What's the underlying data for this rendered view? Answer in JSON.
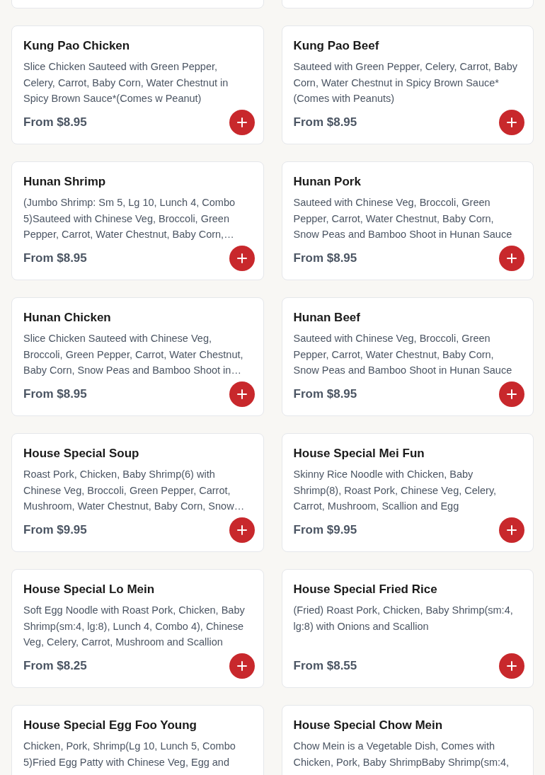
{
  "menu_items": [
    {
      "kind": "cut_off"
    },
    {
      "kind": "cut_off"
    },
    {
      "kind": "dish",
      "title": "Kung Pao Chicken",
      "description": "Slice Chicken Sauteed with Green Pepper, Celery, Carrot, Baby Corn, Water Chestnut in Spicy Brown Sauce*(Comes w Peanut)",
      "price": "From $8.95"
    },
    {
      "kind": "dish",
      "title": "Kung Pao Beef",
      "description": "Sauteed with Green Pepper, Celery, Carrot, Baby Corn, Water Chestnut in Spicy Brown Sauce* (Comes with Peanuts)",
      "price": "From $8.95"
    },
    {
      "kind": "dish",
      "title": "Hunan Shrimp",
      "description": "(Jumbo Shrimp: Sm 5, Lg 10, Lunch 4, Combo 5)Sauteed with Chinese Veg, Broccoli, Green Pepper, Carrot, Water Chestnut, Baby Corn,…",
      "price": "From $8.95"
    },
    {
      "kind": "dish",
      "title": "Hunan Pork",
      "description": "Sauteed with Chinese Veg, Broccoli, Green Pepper, Carrot, Water Chestnut, Baby Corn, Snow Peas and Bamboo Shoot in Hunan Sauce",
      "price": "From $8.95"
    },
    {
      "kind": "dish",
      "title": "Hunan Chicken",
      "description": "Slice Chicken Sauteed with Chinese Veg, Broccoli, Green Pepper, Carrot, Water Chestnut, Baby Corn, Snow Peas and Bamboo Shoot in…",
      "price": "From $8.95"
    },
    {
      "kind": "dish",
      "title": "Hunan Beef",
      "description": "Sauteed with Chinese Veg, Broccoli, Green Pepper, Carrot, Water Chestnut, Baby Corn, Snow Peas and Bamboo Shoot in Hunan Sauce",
      "price": "From $8.95"
    },
    {
      "kind": "dish",
      "title": "House Special Soup",
      "description": "Roast Pork, Chicken, Baby Shrimp(6) with Chinese Veg, Broccoli, Green Pepper, Carrot, Mushroom, Water Chestnut, Baby Corn, Snow…",
      "price": "From $9.95"
    },
    {
      "kind": "dish",
      "title": "House Special Mei Fun",
      "description": "Skinny Rice Noodle with Chicken, Baby Shrimp(8), Roast Pork, Chinese Veg, Celery, Carrot, Mushroom, Scallion and Egg",
      "price": "From $9.95"
    },
    {
      "kind": "dish",
      "title": "House Special Lo Mein",
      "description": "Soft Egg Noodle with Roast Pork, Chicken, Baby Shrimp(sm:4, lg:8), Lunch 4, Combo 4), Chinese Veg, Celery, Carrot, Mushroom and Scallion",
      "price": "From $8.25"
    },
    {
      "kind": "dish",
      "title": "House Special Fried Rice",
      "description": "(Fried) Roast Pork, Chicken, Baby Shrimp(sm:4, lg:8) with Onions and Scallion",
      "price": "From $8.55"
    },
    {
      "kind": "dish",
      "title": "House Special Egg Foo Young",
      "description": "Chicken, Pork, Shrimp(Lg 10, Lunch 5, Combo 5)Fried Egg Patty with Chinese Veg, Egg and"
    },
    {
      "kind": "dish",
      "title": "House Special Chow Mein",
      "description": "Chow Mein is a Vegetable Dish, Comes with Chicken, Pork, Baby ShrimpBaby Shrimp(sm:4,"
    }
  ]
}
